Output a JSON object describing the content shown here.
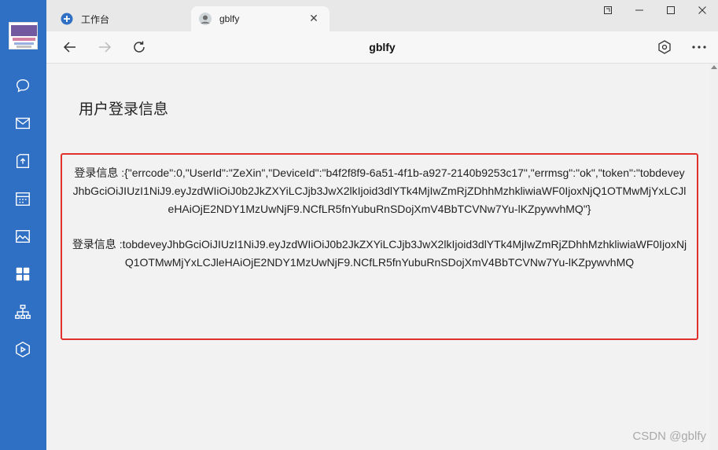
{
  "tabs": [
    {
      "label": "工作台"
    },
    {
      "label": "gblfy"
    }
  ],
  "navbar": {
    "title": "gblfy"
  },
  "page": {
    "heading": "用户登录信息",
    "lines": [
      "登录信息 :{\"errcode\":0,\"UserId\":\"ZeXin\",\"DeviceId\":\"b4f2f8f9-6a51-4f1b-a927-2140b9253c17\",\"errmsg\":\"ok\",\"token\":\"tobdeveyJhbGciOiJIUzI1NiJ9.eyJzdWIiOiJ0b2JkZXYiLCJjb3JwX2lkIjoid3dlYTk4MjIwZmRjZDhhMzhkliwiaWF0IjoxNjQ1OTMwMjYxLCJleHAiOjE2NDY1MzUwNjF9.NCfLR5fnYubuRnSDojXmV4BbTCVNw7Yu-lKZpywvhMQ\"}",
      "登录信息 :tobdeveyJhbGciOiJIUzI1NiJ9.eyJzdWIiOiJ0b2JkZXYiLCJjb3JwX2lkIjoid3dlYTk4MjIwZmRjZDhhMzhkliwiaWF0IjoxNjQ1OTMwMjYxLCJleHAiOjE2NDY1MzUwNjF9.NCfLR5fnYubuRnSDojXmV4BbTCVNw7Yu-lKZpywvhMQ"
    ]
  },
  "watermark": "CSDN @gblfy",
  "colors": {
    "rail": "#2f6fc4",
    "highlight_border": "#e0312c"
  }
}
